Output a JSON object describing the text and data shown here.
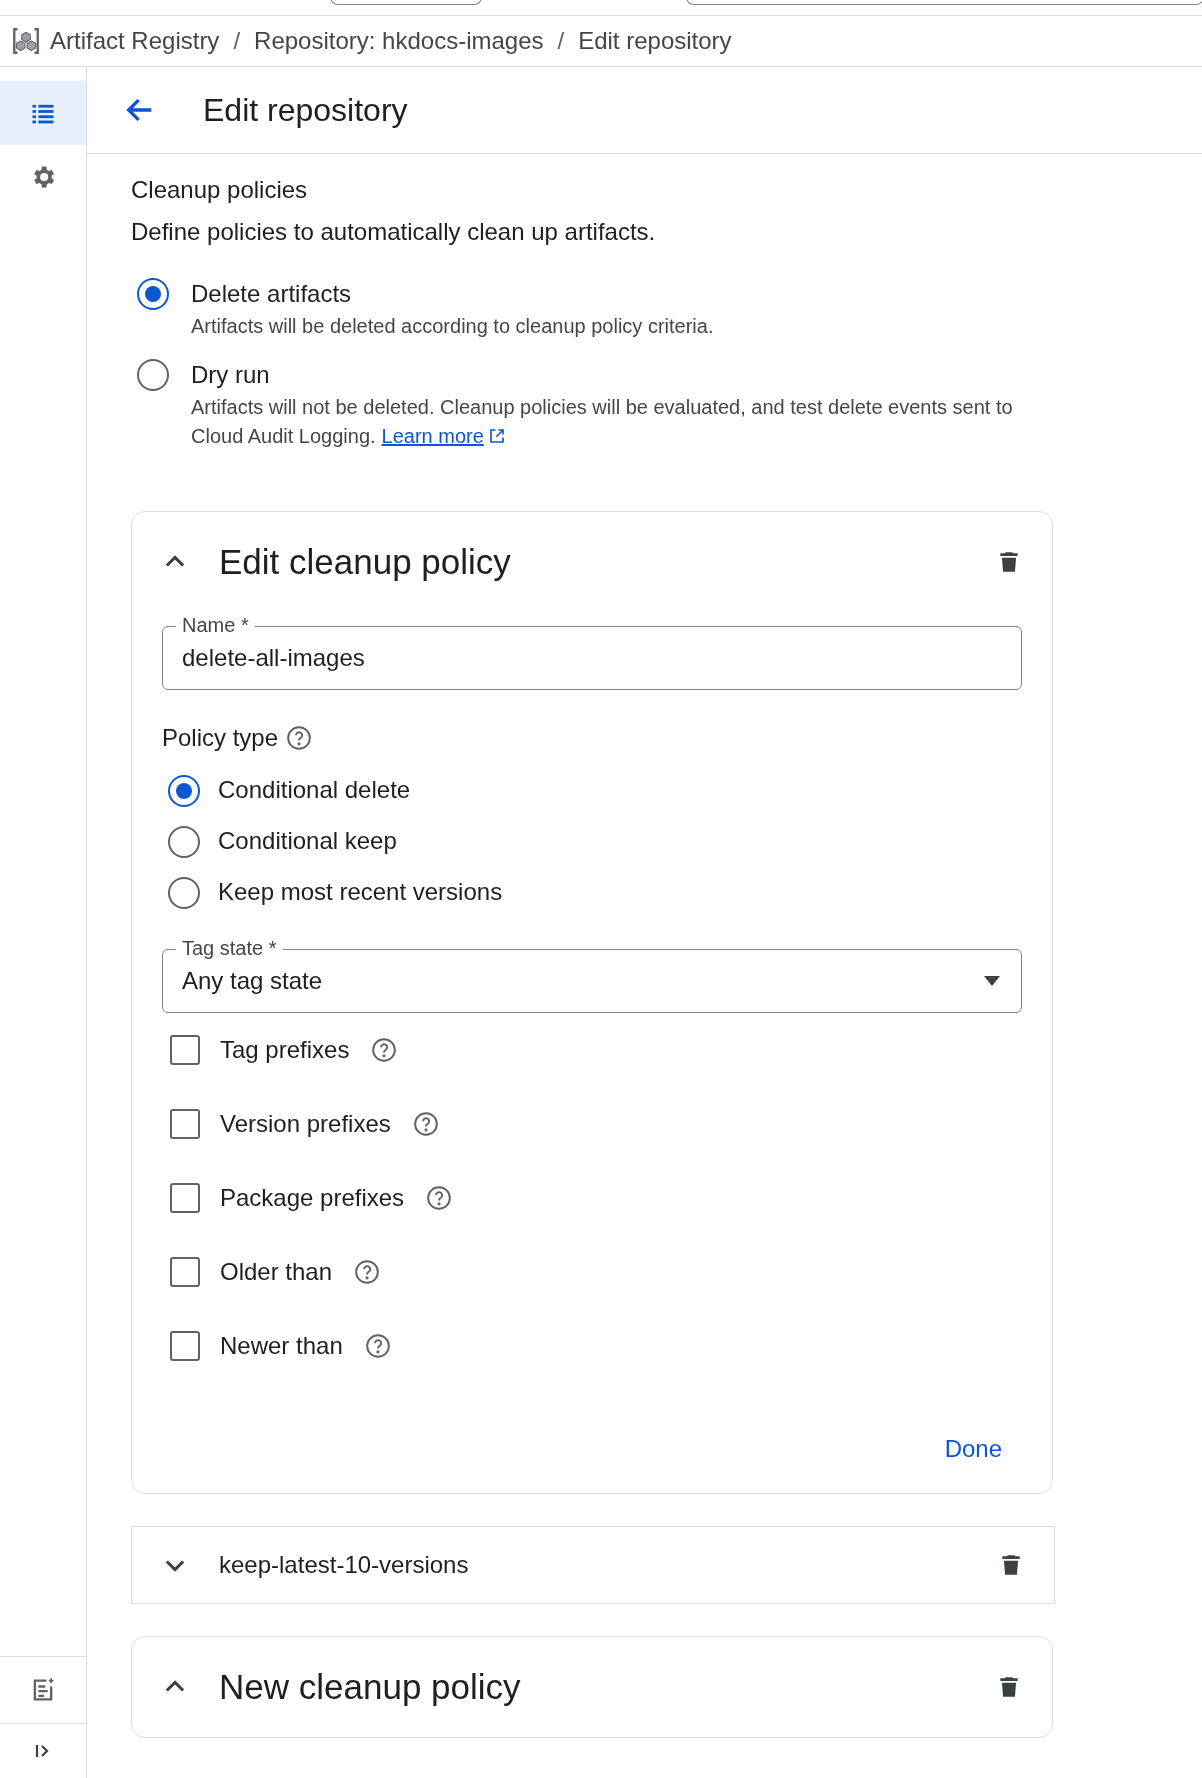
{
  "breadcrumb": {
    "items": [
      "Artifact Registry",
      "Repository: hkdocs-images",
      "Edit repository"
    ],
    "separators": [
      "/",
      "/"
    ]
  },
  "sidebar": {
    "items": [
      {
        "kind": "list",
        "selected": true
      },
      {
        "kind": "settings",
        "selected": false
      }
    ]
  },
  "header": {
    "title": "Edit repository"
  },
  "cleanup": {
    "title": "Cleanup policies",
    "description": "Define policies to automatically clean up artifacts.",
    "modes": [
      {
        "label": "Delete artifacts",
        "description": "Artifacts will be deleted according to cleanup policy criteria.",
        "selected": true
      },
      {
        "label": "Dry run",
        "description": "Artifacts will not be deleted. Cleanup policies will be evaluated, and test delete events sent to Cloud Audit Logging.",
        "link": "Learn more",
        "selected": false
      }
    ]
  },
  "policies": [
    {
      "title": "Edit cleanup policy",
      "expanded": true,
      "name_field": {
        "label": "Name *",
        "value": "delete-all-images"
      },
      "policy_type": {
        "label": "Policy type",
        "options": [
          {
            "label": "Conditional delete",
            "selected": true
          },
          {
            "label": "Conditional keep",
            "selected": false
          },
          {
            "label": "Keep most recent versions",
            "selected": false
          }
        ]
      },
      "tag_state": {
        "label": "Tag state *",
        "value": "Any tag state"
      },
      "conditions": [
        {
          "label": "Tag prefixes",
          "checked": false
        },
        {
          "label": "Version prefixes",
          "checked": false
        },
        {
          "label": "Package prefixes",
          "checked": false
        },
        {
          "label": "Older than",
          "checked": false
        },
        {
          "label": "Newer than",
          "checked": false
        }
      ],
      "done": "Done"
    },
    {
      "title": "keep-latest-10-versions",
      "expanded": false
    },
    {
      "title": "New cleanup policy",
      "expanded": true
    }
  ]
}
